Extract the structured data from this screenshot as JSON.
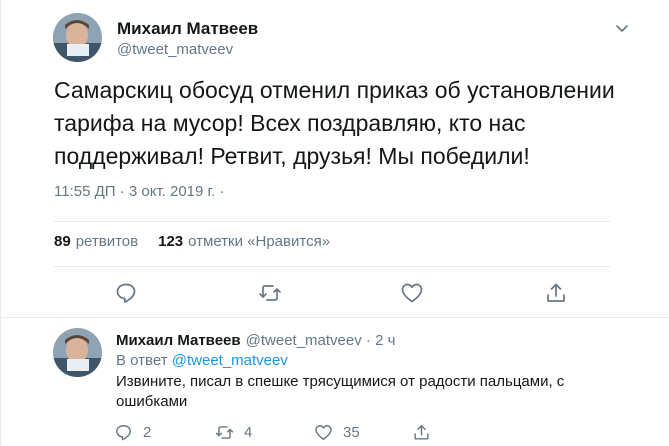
{
  "main_tweet": {
    "author_name": "Михаил Матвеев",
    "handle": "@tweet_matveev",
    "text": "Самарскиц обосуд отменил приказ об установлении тарифа на мусор! Всех поздравляю, кто нас поддерживал! Ретвит, друзья! Мы победили!",
    "timestamp": "11:55 ДП · 3 окт. 2019 г. ·",
    "retweets_count": "89",
    "retweets_label": "ретвитов",
    "likes_count": "123",
    "likes_label": "отметки «Нравится»",
    "actions": [
      "reply-icon",
      "retweet-icon",
      "like-icon",
      "share-icon"
    ]
  },
  "reply_tweet": {
    "author_name": "Михаил Матвеев",
    "meta": "@tweet_matveev · 2 ч",
    "reply_to_label": "В ответ",
    "reply_to_handle": "@tweet_matveev",
    "text": "Извините, писал в спешке трясущимися от радости пальцами, с ошибками",
    "reply_count": "2",
    "retweet_count": "4",
    "like_count": "35"
  },
  "colors": {
    "text": "#14171a",
    "secondary": "#657786",
    "link": "#1b95e0",
    "divider": "#e6ecf0"
  }
}
